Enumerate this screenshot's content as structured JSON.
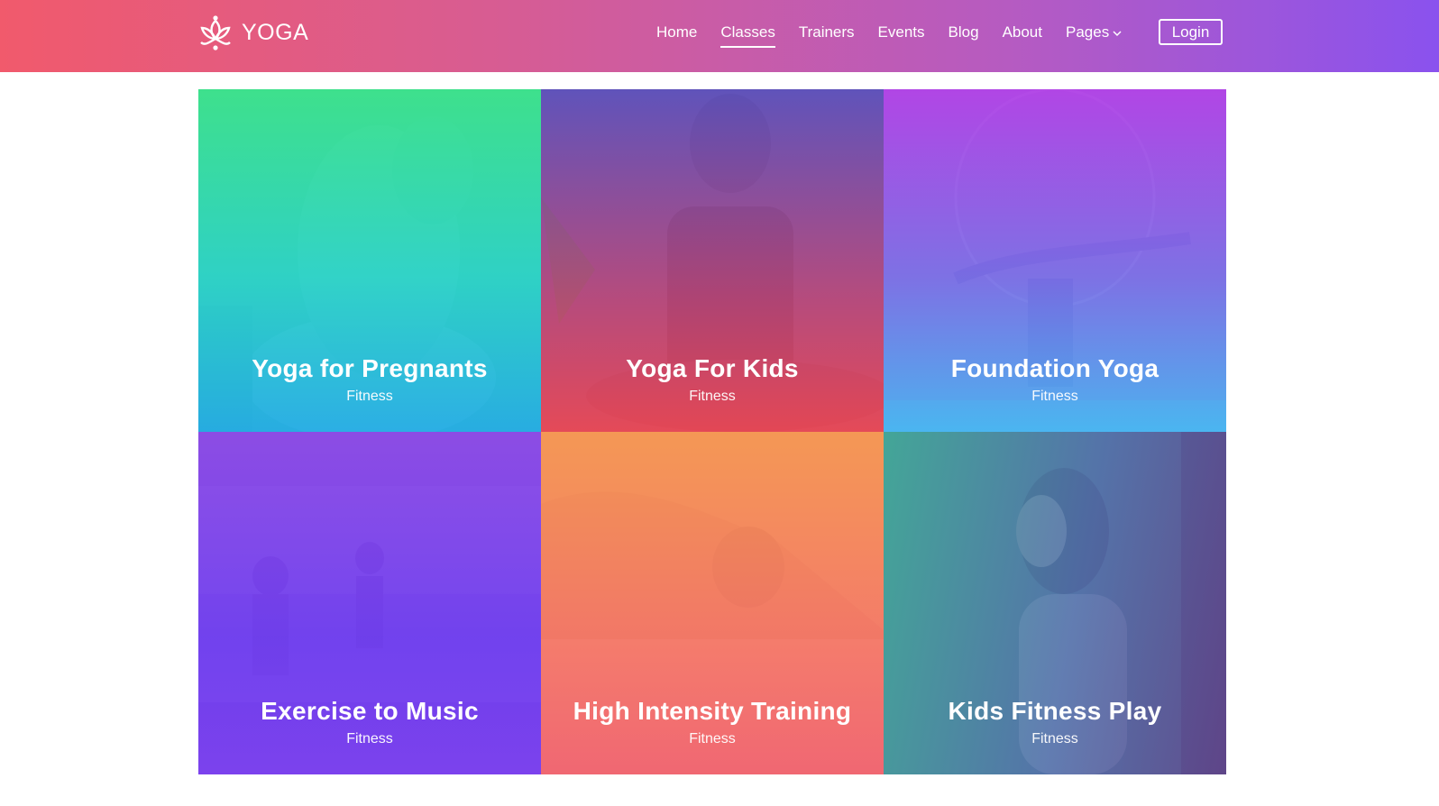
{
  "brand": {
    "name": "YOGA",
    "logo_icon": "lotus-icon"
  },
  "nav": {
    "items": [
      {
        "label": "Home",
        "active": false
      },
      {
        "label": "Classes",
        "active": true
      },
      {
        "label": "Trainers",
        "active": false
      },
      {
        "label": "Events",
        "active": false
      },
      {
        "label": "Blog",
        "active": false
      },
      {
        "label": "About",
        "active": false
      },
      {
        "label": "Pages",
        "active": false,
        "dropdown_icon": "chevron-down-icon"
      }
    ],
    "login_label": "Login"
  },
  "classes": [
    {
      "title": "Yoga for Pregnants",
      "category": "Fitness"
    },
    {
      "title": "Yoga For Kids",
      "category": "Fitness"
    },
    {
      "title": "Foundation Yoga",
      "category": "Fitness"
    },
    {
      "title": "Exercise to Music",
      "category": "Fitness"
    },
    {
      "title": "High Intensity Training",
      "category": "Fitness"
    },
    {
      "title": "Kids Fitness Play",
      "category": "Fitness"
    }
  ],
  "colors": {
    "header_start": "#f15a6c",
    "header_end": "#8a52ee",
    "text": "#ffffff"
  }
}
